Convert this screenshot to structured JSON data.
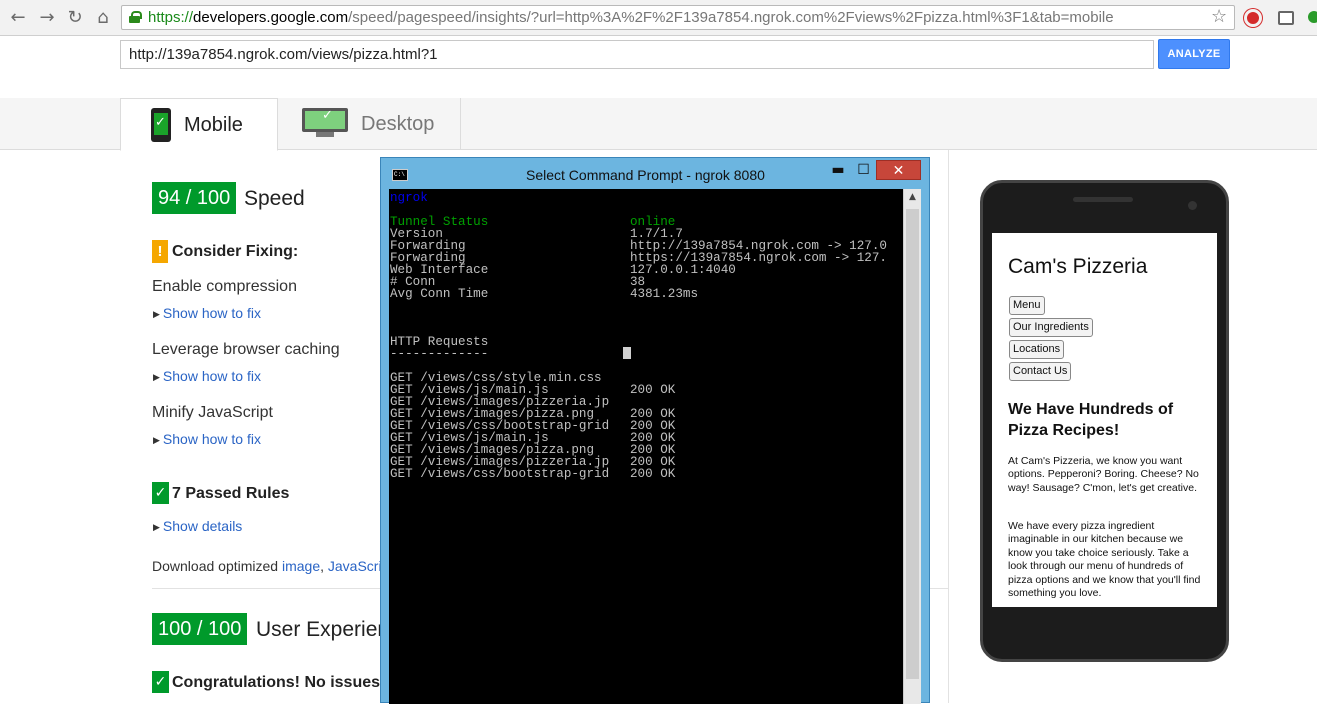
{
  "browser": {
    "url_https": "https://",
    "url_host": "developers.google.com",
    "url_rest": "/speed/pagespeed/insights/?url=http%3A%2F%2F139a7854.ngrok.com%2Fviews%2Fpizza.html%3F1&tab=mobile",
    "icons": [
      "back-icon",
      "forward-icon",
      "reload-icon",
      "home-icon",
      "lock-icon",
      "star-icon"
    ]
  },
  "analyze": {
    "input_value": "http://139a7854.ngrok.com/views/pizza.html?1",
    "button_label": "ANALYZE"
  },
  "tabs": [
    {
      "label": "Mobile",
      "active": true
    },
    {
      "label": "Desktop",
      "active": false
    }
  ],
  "speed": {
    "score": "94 / 100",
    "label": "Speed",
    "consider_title": "Consider Fixing:",
    "rules": [
      {
        "name": "Enable compression",
        "link": "Show how to fix"
      },
      {
        "name": "Leverage browser caching",
        "link": "Show how to fix"
      },
      {
        "name": "Minify JavaScript",
        "link": "Show how to fix"
      }
    ],
    "passed_title": "7 Passed Rules",
    "passed_link": "Show details",
    "download_prefix": "Download optimized",
    "download_image": "image",
    "download_js": "JavaScri"
  },
  "ux": {
    "score": "100 / 100",
    "label": "User Experien",
    "congrats": "Congratulations! No issues"
  },
  "cmd": {
    "title": "Select Command Prompt - ngrok  8080",
    "header": "ngrok",
    "status_rows": [
      {
        "key": "Tunnel Status",
        "value": "online",
        "green": true
      },
      {
        "key": "Version",
        "value": "1.7/1.7"
      },
      {
        "key": "Forwarding",
        "value": "http://139a7854.ngrok.com -> 127.0"
      },
      {
        "key": "Forwarding",
        "value": "https://139a7854.ngrok.com -> 127."
      },
      {
        "key": "Web Interface",
        "value": "127.0.0.1:4040"
      },
      {
        "key": "# Conn",
        "value": "38"
      },
      {
        "key": "Avg Conn Time",
        "value": "4381.23ms"
      }
    ],
    "requests_title": "HTTP Requests",
    "requests_rule": "-------------",
    "requests": [
      {
        "path": "GET /views/css/style.min.css",
        "status": ""
      },
      {
        "path": "GET /views/js/main.js",
        "status": "200 OK"
      },
      {
        "path": "GET /views/images/pizzeria.jp",
        "status": ""
      },
      {
        "path": "GET /views/images/pizza.png",
        "status": "200 OK"
      },
      {
        "path": "GET /views/css/bootstrap-grid",
        "status": "200 OK"
      },
      {
        "path": "GET /views/js/main.js",
        "status": "200 OK"
      },
      {
        "path": "GET /views/images/pizza.png",
        "status": "200 OK"
      },
      {
        "path": "GET /views/images/pizzeria.jp",
        "status": "200 OK"
      },
      {
        "path": "GET /views/css/bootstrap-grid",
        "status": "200 OK"
      }
    ],
    "close": "✕",
    "minimize": "▬",
    "maximize": "☐"
  },
  "preview": {
    "title": "Cam's Pizzeria",
    "buttons": [
      "Menu",
      "Our Ingredients",
      "Locations",
      "Contact Us"
    ],
    "heading": "We Have Hundreds of Pizza Recipes!",
    "para1": "At Cam's Pizzeria, we know you want options. Pepperoni? Boring. Cheese? No way! Sausage? C'mon, let's get creative.",
    "para2": "We have every pizza ingredient imaginable in our kitchen because we know you take choice seriously. Take a look through our menu of hundreds of pizza options and we know that you'll find something you love."
  },
  "colors": {
    "score_green": "#009a2b",
    "warn_orange": "#f5a700",
    "link_blue": "#2a64c5",
    "analyze_blue": "#4d90fe",
    "cmd_title_blue": "#6cb5e0"
  }
}
